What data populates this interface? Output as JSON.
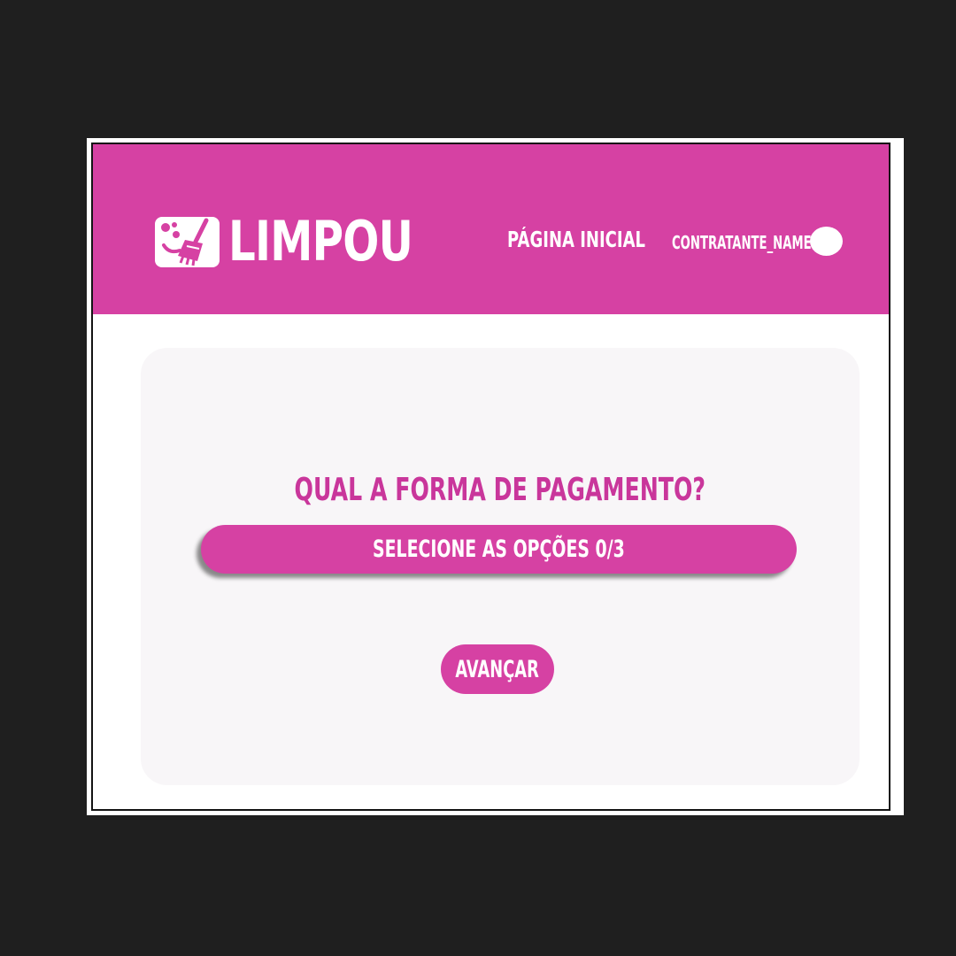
{
  "header": {
    "logo_text": "LIMPOU",
    "logo_icon": "broom-icon",
    "nav_home_label": "PÁGINA INICIAL",
    "user_name": "CONTRATANTE_NAME"
  },
  "main": {
    "question": "QUAL A FORMA DE PAGAMENTO?",
    "select_label": "SELECIONE AS OPÇÕES 0/3",
    "next_label": "AVANÇAR"
  },
  "colors": {
    "brand": "#d641a3",
    "question_text": "#c9369b",
    "card_background": "#f8f6f8",
    "outer_background": "#1f1f1f"
  }
}
